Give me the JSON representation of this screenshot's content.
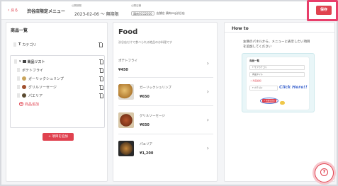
{
  "header": {
    "back_label": "戻る",
    "menu_name": "渋谷店限定メニュー",
    "period_label": "公開期間",
    "period_value": "2023-02-06 ～ 無期限",
    "store_label": "公開店舗",
    "store_badge": "鶏肉SCG2020",
    "store_text": "店舗名  鶏肉scg渋谷店",
    "save_label": "保存"
  },
  "items_panel": {
    "title": "商品一覧",
    "rows": [
      {
        "icon": "text-icon",
        "label": "カテゴリ",
        "type": "category"
      },
      {
        "icon": "list-icon",
        "label": "商品リスト",
        "type": "list"
      },
      {
        "label": "ポテトフライ",
        "type": "item"
      },
      {
        "label": "ガーリックシュリンプ",
        "type": "item"
      },
      {
        "label": "グリルソーセージ",
        "type": "item"
      },
      {
        "label": "パエリア",
        "type": "item"
      }
    ],
    "add_product_label": "商品追加",
    "add_section_label": "+ 項目を追加"
  },
  "preview": {
    "title": "Food",
    "description": "渋谷店だけで食べられる絶品のお料理です",
    "items": [
      {
        "name": "ポテトフライ",
        "price": "¥450"
      },
      {
        "name": "ガーリックシュリンプ",
        "price": "¥650"
      },
      {
        "name": "グリルソーセージ",
        "price": "¥650"
      },
      {
        "name": "パエリア",
        "price": "¥1,200"
      }
    ]
  },
  "howto": {
    "title": "How to",
    "text_line1": "左側のパネルから、メニューに表示したい項目",
    "text_line2": "を追加してください",
    "illustration": {
      "title": "商品一覧",
      "row1": "T サブカテゴリ",
      "row2": "商品タイル",
      "add": "+ 商品追加",
      "row3": "T カテゴリ",
      "click_here": "Click Here!!",
      "button": "+ 項目を追加"
    }
  },
  "colors": {
    "accent": "#e0424f",
    "highlight": "#e83e6a",
    "click": "#4a6fd1"
  },
  "help_icon": "question-icon"
}
